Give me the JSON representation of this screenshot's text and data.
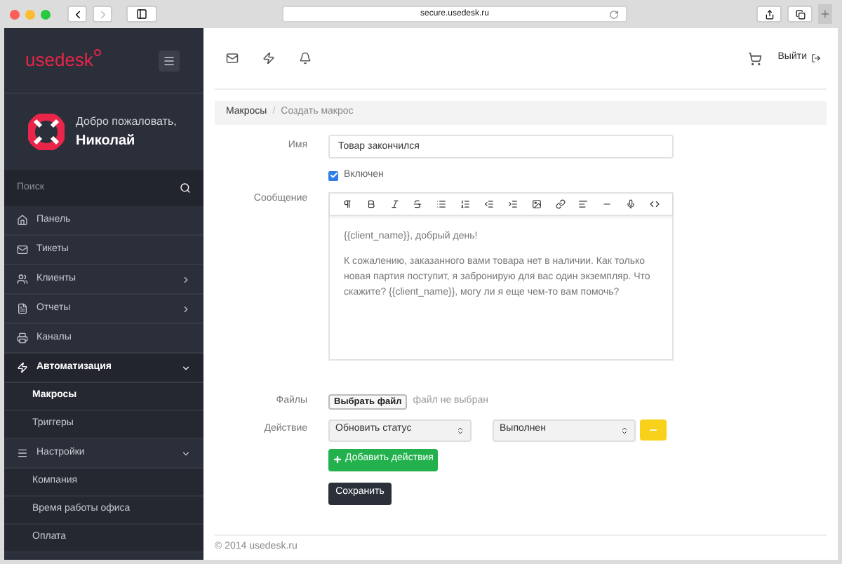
{
  "browser": {
    "url": "secure.usedesk.ru"
  },
  "brand": {
    "logo": "usedesk"
  },
  "user": {
    "greeting": "Добро пожаловать,",
    "name": "Николай"
  },
  "search": {
    "placeholder": "Поиск"
  },
  "sidebar": {
    "items": [
      {
        "label": "Панель",
        "selected": false
      },
      {
        "label": "Тикеты",
        "selected": false
      },
      {
        "label": "Клиенты",
        "selected": false,
        "expanded": false
      },
      {
        "label": "Отчеты",
        "selected": false,
        "expanded": false
      },
      {
        "label": "Каналы",
        "selected": false
      },
      {
        "label": "Автоматизация",
        "selected": true,
        "expanded": true,
        "children": [
          {
            "label": "Макросы",
            "selected": true
          },
          {
            "label": "Триггеры",
            "selected": false
          }
        ]
      },
      {
        "label": "Настройки",
        "selected": false,
        "expanded": true,
        "children": [
          {
            "label": "Компания",
            "selected": false
          },
          {
            "label": "Время работы офиса",
            "selected": false
          },
          {
            "label": "Оплата",
            "selected": false
          }
        ]
      }
    ]
  },
  "header": {
    "logout": "Выйти"
  },
  "breadcrumb": [
    "Макросы",
    "Создать макрос"
  ],
  "breadcrumb_separator": "/",
  "form": {
    "name_label": "Имя",
    "name_value": "Товар закончился",
    "enabled": {
      "label": "Включен",
      "checked": true
    },
    "message_label": "Сообщение",
    "message": [
      "{{client_name}}, добрый день!",
      "К сожалению, заказанного вами товара нет в наличии. Как только новая партия поступит, я забронирую для вас один экземпляр. Что скажите? {{client_name}}, могу ли я еще чем-то вам помочь?"
    ],
    "files_label": "Файлы",
    "file_button": "Выбрать файл",
    "file_status": "файл не выбран",
    "actions_label": "Действие",
    "action_select": "Обновить статус",
    "status_select": "Выполнен",
    "add_button": "Добавить действия",
    "save_button": "Сохранить"
  },
  "footer": "© 2014 usedesk.ru"
}
